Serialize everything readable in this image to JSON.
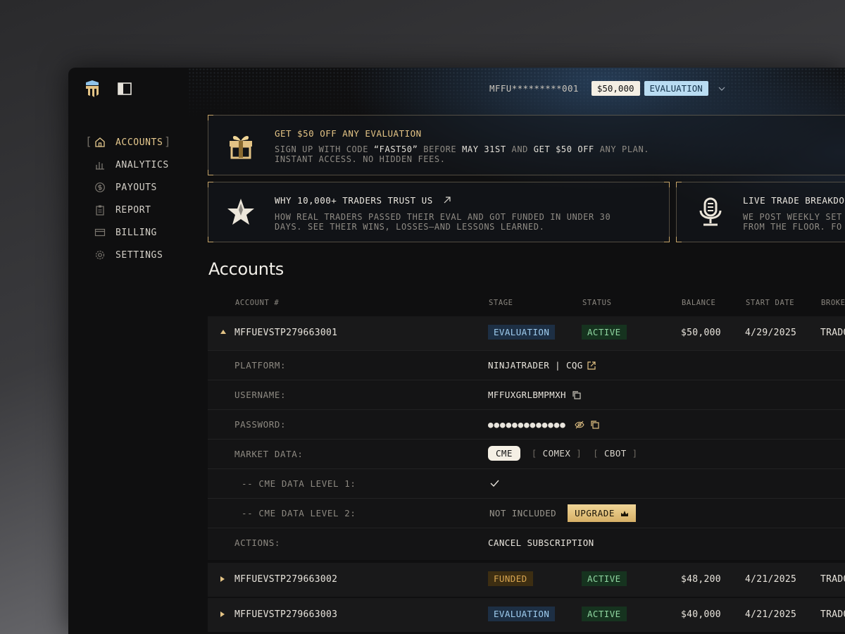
{
  "header": {
    "account_id": "MFFU*********001",
    "balance": "$50,000",
    "stage": "EVALUATION"
  },
  "sidebar": {
    "items": [
      {
        "label": "ACCOUNTS",
        "icon": "home-icon",
        "active": true
      },
      {
        "label": "ANALYTICS",
        "icon": "bar-chart-icon"
      },
      {
        "label": "PAYOUTS",
        "icon": "dollar-icon"
      },
      {
        "label": "REPORT",
        "icon": "clipboard-icon"
      },
      {
        "label": "BILLING",
        "icon": "card-icon"
      },
      {
        "label": "SETTINGS",
        "icon": "gear-icon"
      }
    ]
  },
  "promos": [
    {
      "title": "GET $50 OFF ANY EVALUATION",
      "desc1_pre": "SIGN UP WITH CODE ",
      "desc1_code": "“FAST50”",
      "desc1_mid": " BEFORE ",
      "desc1_date": "MAY 31ST",
      "desc1_and": " AND ",
      "desc1_offer": "GET $50 OFF",
      "desc1_post": " ANY PLAN.",
      "desc2": "INSTANT ACCESS. NO HIDDEN FEES.",
      "icon": "gift-icon"
    },
    {
      "title": "WHY 10,000+ TRADERS TRUST US",
      "desc1": "HOW REAL TRADERS PASSED THEIR EVAL AND GOT FUNDED IN UNDER 30",
      "desc2": "DAYS. SEE THEIR WINS, LOSSES—AND LESSONS LEARNED.",
      "icon": "star-icon"
    },
    {
      "title": "LIVE TRADE BREAKDO",
      "desc1": "WE POST WEEKLY SET",
      "desc2": "FROM THE FLOOR. FO",
      "icon": "microphone-icon"
    }
  ],
  "accounts": {
    "title": "Accounts",
    "columns": [
      "ACCOUNT #",
      "STAGE",
      "STATUS",
      "BALANCE",
      "START DATE",
      "BROKE"
    ],
    "rows": [
      {
        "id": "MFFUEVSTP279663001",
        "stage": "EVALUATION",
        "status": "ACTIVE",
        "balance": "$50,000",
        "start": "4/29/2025",
        "broker": "TRADO"
      },
      {
        "id": "MFFUEVSTP279663002",
        "stage": "FUNDED",
        "status": "ACTIVE",
        "balance": "$48,200",
        "start": "4/21/2025",
        "broker": "TRADO"
      },
      {
        "id": "MFFUEVSTP279663003",
        "stage": "EVALUATION",
        "status": "ACTIVE",
        "balance": "$40,000",
        "start": "4/21/2025",
        "broker": "TRADO"
      }
    ],
    "details": {
      "platform_label": "PLATFORM:",
      "platform_value": "NINJATRADER | CQG",
      "username_label": "USERNAME:",
      "username_value": "MFFUXGRLBMPMXH",
      "password_label": "PASSWORD:",
      "password_value": "●●●●●●●●●●●●●",
      "market_label": "MARKET DATA:",
      "market_selected": "CME",
      "market_opt1": "COMEX",
      "market_opt2": "CBOT",
      "level1_label": "-- CME DATA LEVEL 1:",
      "level2_label": "-- CME DATA LEVEL 2:",
      "level2_value": "NOT INCLUDED",
      "upgrade_label": "UPGRADE",
      "actions_label": "ACTIONS:",
      "actions_value": "CANCEL SUBSCRIPTION"
    }
  },
  "colors": {
    "accent": "#e3c385",
    "danger": "#e8605a",
    "eval": "#9fcdf0",
    "active": "#8fd6a0"
  }
}
